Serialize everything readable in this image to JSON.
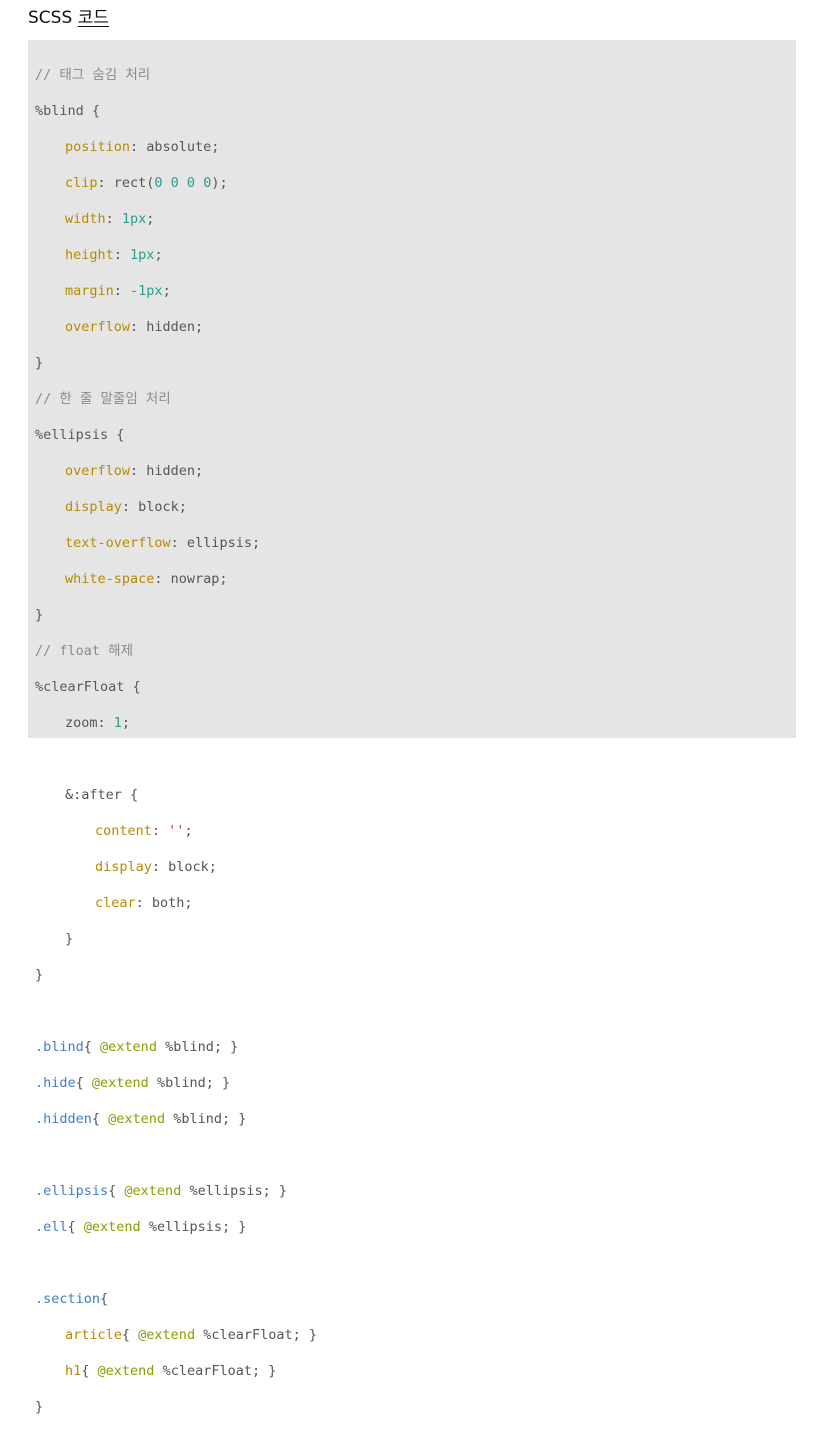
{
  "heading": {
    "prefix": "SCSS ",
    "link": "코드"
  },
  "code": {
    "c1": "// 태그 숨김 처리",
    "blind_sel": "%blind {",
    "p_position": "position",
    "v_position": ": absolute;",
    "p_clip": "clip",
    "v_clip_a": ": rect(",
    "v_clip_n": "0 0 0 0",
    "v_clip_b": ");",
    "p_width": "width",
    "v_width_a": ": ",
    "v_width_n": "1px",
    "v_width_b": ";",
    "p_height": "height",
    "v_height_a": ": ",
    "v_height_n": "1px",
    "v_height_b": ";",
    "p_margin": "margin",
    "v_margin_a": ": ",
    "v_margin_n": "-1px",
    "v_margin_b": ";",
    "p_overflow": "overflow",
    "v_overflow": ": hidden;",
    "close1": "}",
    "c2": "// 한 줄 말줄임 처리",
    "ellipsis_sel": "%ellipsis {",
    "p_overflow2": "overflow",
    "v_overflow2": ": hidden;",
    "p_display": "display",
    "v_display": ": block;",
    "p_textoverflow": "text-overflow",
    "v_textoverflow": ": ellipsis;",
    "p_whitespace": "white-space",
    "v_whitespace": ": nowrap;",
    "close2": "}",
    "c3": "// float 해제",
    "clear_sel": "%clearFloat {",
    "p_zoom": "zoom",
    "v_zoom_a": ": ",
    "v_zoom_n": "1",
    "v_zoom_b": ";",
    "after_sel": "&:after {",
    "p_content": "content",
    "v_content_a": ": ",
    "v_content_s": "''",
    "v_content_b": ";",
    "p_display2": "display",
    "v_display2": ": block;",
    "p_clear": "clear",
    "v_clear": ": both;",
    "close_after": "}",
    "close3": "}",
    "r1_sel": ".blind",
    "r1_a": "{ ",
    "r1_at": "@extend",
    "r1_b": " %blind; }",
    "r2_sel": ".hide",
    "r2_a": "{ ",
    "r2_at": "@extend",
    "r2_b": " %blind; }",
    "r3_sel": ".hidden",
    "r3_a": "{ ",
    "r3_at": "@extend",
    "r3_b": " %blind; }",
    "r4_sel": ".ellipsis",
    "r4_a": "{ ",
    "r4_at": "@extend",
    "r4_b": " %ellipsis; }",
    "r5_sel": ".ell",
    "r5_a": "{ ",
    "r5_at": "@extend",
    "r5_b": " %ellipsis; }",
    "r6_sel": ".section",
    "r6_a": "{",
    "r7_el": "article",
    "r7_a": "{ ",
    "r7_at": "@extend",
    "r7_b": " %clearFloat; }",
    "r8_el": "h1",
    "r8_a": "{ ",
    "r8_at": "@extend",
    "r8_b": " %clearFloat; }",
    "close4": "}"
  }
}
